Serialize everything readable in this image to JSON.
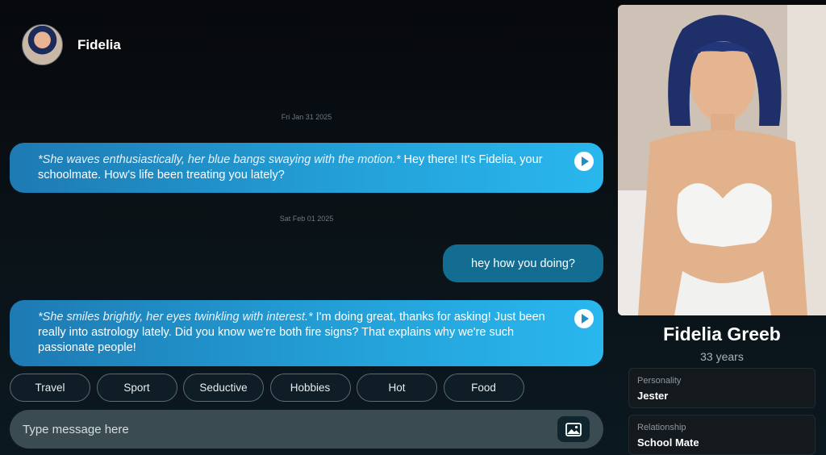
{
  "header": {
    "name": "Fidelia"
  },
  "messages": [
    {
      "type": "date",
      "text": "Fri Jan 31 2025"
    },
    {
      "type": "incoming",
      "action": "*She waves enthusiastically, her blue bangs swaying with the motion.*",
      "text": " Hey there! It's Fidelia, your schoolmate. How's life been treating you lately?"
    },
    {
      "type": "date",
      "text": "Sat Feb 01 2025"
    },
    {
      "type": "outgoing",
      "text": "hey how you doing?"
    },
    {
      "type": "incoming",
      "action": "*She smiles brightly, her eyes twinkling with interest.*",
      "text": " I'm doing great, thanks for asking! Just been really into astrology lately. Did you know we're both fire signs? That explains why we're such passionate people!"
    }
  ],
  "chips": [
    "Travel",
    "Sport",
    "Seductive",
    "Hobbies",
    "Hot",
    "Food"
  ],
  "composer": {
    "placeholder": "Type message here"
  },
  "profile": {
    "name": "Fidelia Greeb",
    "age": "33 years",
    "personality_label": "Personality",
    "personality_value": "Jester",
    "relationship_label": "Relationship",
    "relationship_value": "School Mate"
  },
  "colors": {
    "accent": "#29b7ee",
    "outgoing": "#136d93",
    "background": "#0a1318"
  }
}
